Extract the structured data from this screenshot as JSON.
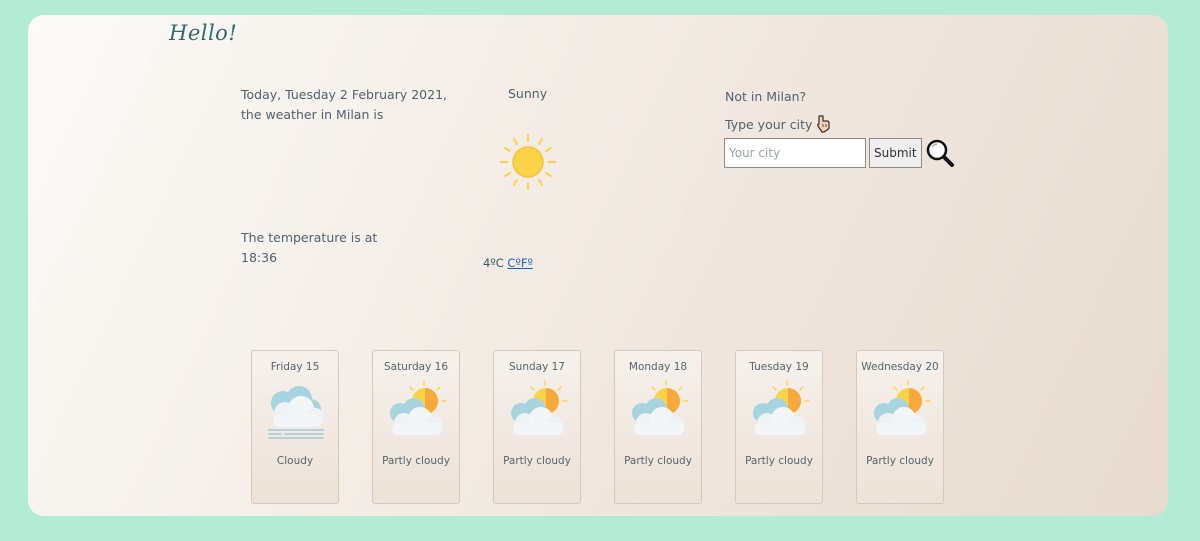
{
  "greeting": "Hello!",
  "current": {
    "intro": "Today, Tuesday 2 February 2021, the weather in Milan is",
    "condition": "Sunny",
    "condition_icon": "sun-icon",
    "temperature_intro": "The temperature is at 18:36",
    "temperature_value": "4ºC",
    "unit_link": "CºFº"
  },
  "search": {
    "question": "Not in Milan?",
    "prompt": "Type your city",
    "prompt_icon": "pointing-down-icon",
    "placeholder": "Your city",
    "value": "",
    "submit_label": "Submit",
    "search_icon": "magnifier-icon"
  },
  "forecast": [
    {
      "day": "Friday 15",
      "description": "Cloudy",
      "icon": "fog-cloud-icon"
    },
    {
      "day": "Saturday 16",
      "description": "Partly cloudy",
      "icon": "partly-cloudy-icon"
    },
    {
      "day": "Sunday 17",
      "description": "Partly cloudy",
      "icon": "partly-cloudy-icon"
    },
    {
      "day": "Monday 18",
      "description": "Partly cloudy",
      "icon": "partly-cloudy-icon"
    },
    {
      "day": "Tuesday 19",
      "description": "Partly cloudy",
      "icon": "partly-cloudy-icon"
    },
    {
      "day": "Wednesday 20",
      "description": "Partly cloudy",
      "icon": "partly-cloudy-icon"
    }
  ],
  "colors": {
    "background": "#b3ebd4",
    "sun": "#fcd347",
    "sun_orange": "#f7a93b",
    "cloud": "#f0f4f6",
    "cloud_shadow": "#a8d4e0",
    "link": "#1a5fcb"
  }
}
